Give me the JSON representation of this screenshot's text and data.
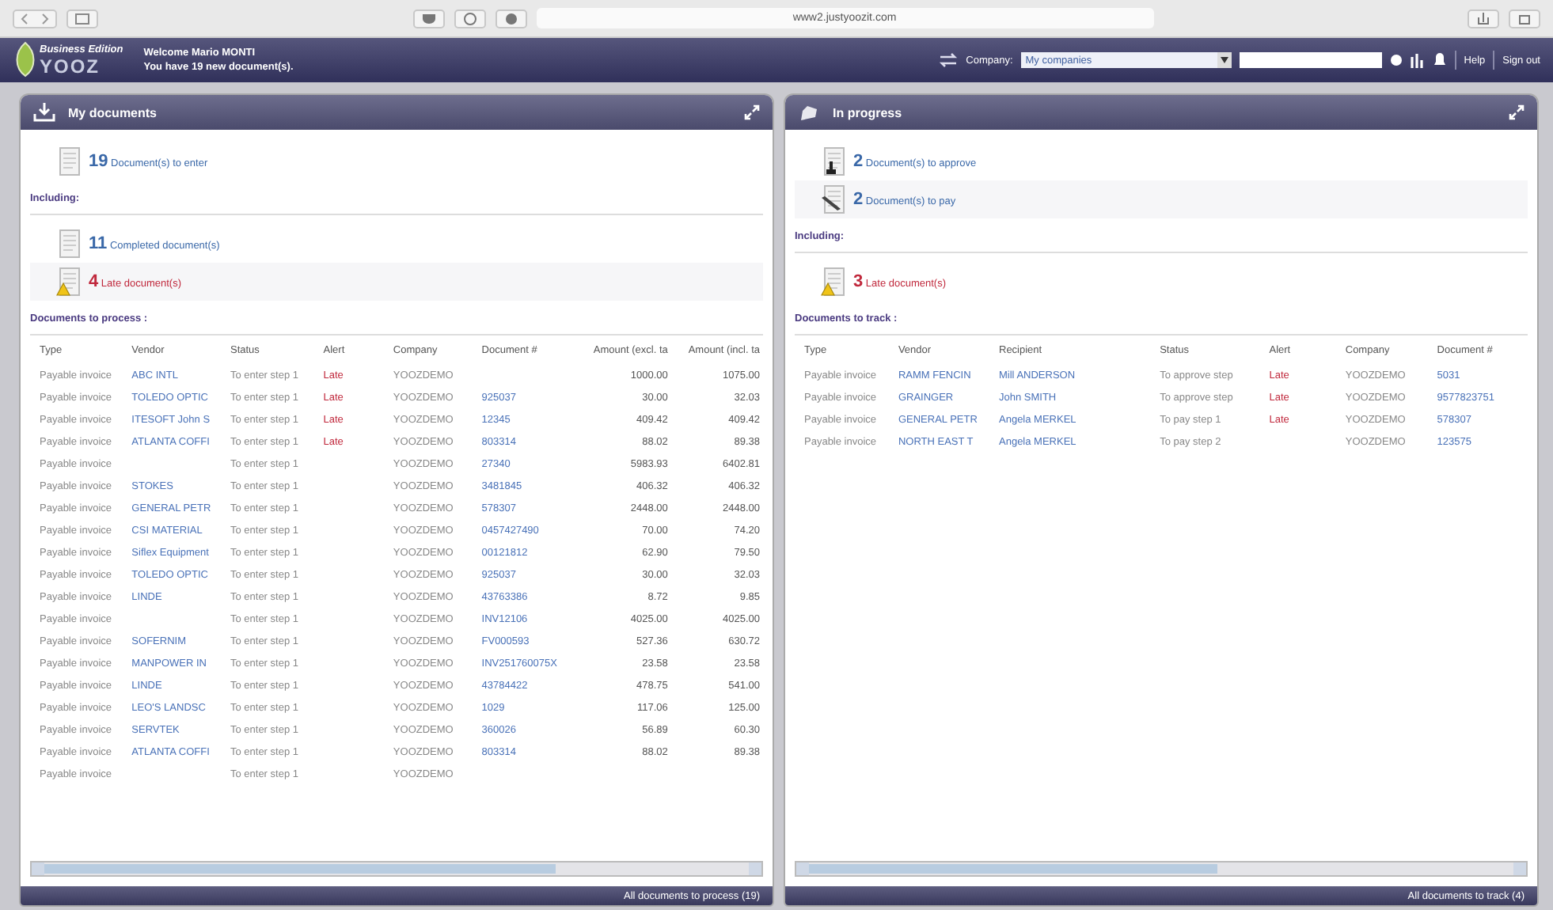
{
  "browser": {
    "url": "www2.justyoozit.com"
  },
  "header": {
    "logo": "YOOZ",
    "edition": "Business Edition",
    "welcome": "Welcome Mario MONTI",
    "new_docs": "You have **19** new document(s).",
    "company_label": "Company:",
    "company_value": "My companies",
    "help": "Help",
    "sign_out": "Sign out"
  },
  "panels": [
    {
      "title": "My documents",
      "summary": [
        {
          "count": "19",
          "label": "Document(s) to enter",
          "kind": "enter"
        }
      ],
      "including": "Including:",
      "sub_summary": [
        {
          "count": "11",
          "label": "Completed document(s)",
          "kind": "completed"
        },
        {
          "count": "4",
          "label": "Late document(s)",
          "kind": "late"
        }
      ],
      "section": "Documents to process :",
      "columns": [
        {
          "label": "Type",
          "kind": "text"
        },
        {
          "label": "Vendor",
          "kind": "link"
        },
        {
          "label": "Status",
          "kind": "text"
        },
        {
          "label": "Alert",
          "kind": "alert"
        },
        {
          "label": "Company",
          "kind": "text"
        },
        {
          "label": "Document #",
          "kind": "link"
        },
        {
          "label": "Amount (excl. ta",
          "kind": "number"
        },
        {
          "label": "Amount (incl. ta",
          "kind": "number"
        }
      ],
      "rows": [
        [
          "Payable invoice",
          "ABC INTL",
          "To enter step 1",
          "Late",
          "YOOZDEMO",
          null,
          "1000.00",
          "1075.00"
        ],
        [
          "Payable invoice",
          "TOLEDO OPTIC",
          "To enter step 1",
          "Late",
          "YOOZDEMO",
          "925037",
          "30.00",
          "32.03"
        ],
        [
          "Payable invoice",
          "ITESOFT John S",
          "To enter step 1",
          "Late",
          "YOOZDEMO",
          "12345",
          "409.42",
          "409.42"
        ],
        [
          "Payable invoice",
          "ATLANTA COFFI",
          "To enter step 1",
          "Late",
          "YOOZDEMO",
          "803314",
          "88.02",
          "89.38"
        ],
        [
          "Payable invoice",
          null,
          "To enter step 1",
          null,
          "YOOZDEMO",
          "27340",
          "5983.93",
          "6402.81"
        ],
        [
          "Payable invoice",
          "STOKES",
          "To enter step 1",
          null,
          "YOOZDEMO",
          "3481845",
          "406.32",
          "406.32"
        ],
        [
          "Payable invoice",
          "GENERAL PETR",
          "To enter step 1",
          null,
          "YOOZDEMO",
          "578307",
          "2448.00",
          "2448.00"
        ],
        [
          "Payable invoice",
          "CSI MATERIAL",
          "To enter step 1",
          null,
          "YOOZDEMO",
          "0457427490",
          "70.00",
          "74.20"
        ],
        [
          "Payable invoice",
          "Siflex Equipment",
          "To enter step 1",
          null,
          "YOOZDEMO",
          "00121812",
          "62.90",
          "79.50"
        ],
        [
          "Payable invoice",
          "TOLEDO OPTIC",
          "To enter step 1",
          null,
          "YOOZDEMO",
          "925037",
          "30.00",
          "32.03"
        ],
        [
          "Payable invoice",
          "LINDE",
          "To enter step 1",
          null,
          "YOOZDEMO",
          "43763386",
          "8.72",
          "9.85"
        ],
        [
          "Payable invoice",
          null,
          "To enter step 1",
          null,
          "YOOZDEMO",
          "INV12106",
          "4025.00",
          "4025.00"
        ],
        [
          "Payable invoice",
          "SOFERNIM",
          "To enter step 1",
          null,
          "YOOZDEMO",
          "FV000593",
          "527.36",
          "630.72"
        ],
        [
          "Payable invoice",
          "MANPOWER IN",
          "To enter step 1",
          null,
          "YOOZDEMO",
          "INV251760075X",
          "23.58",
          "23.58"
        ],
        [
          "Payable invoice",
          "LINDE",
          "To enter step 1",
          null,
          "YOOZDEMO",
          "43784422",
          "478.75",
          "541.00"
        ],
        [
          "Payable invoice",
          "LEO'S LANDSC",
          "To enter step 1",
          null,
          "YOOZDEMO",
          "1029",
          "117.06",
          "125.00"
        ],
        [
          "Payable invoice",
          "SERVTEK",
          "To enter step 1",
          null,
          "YOOZDEMO",
          "360026",
          "56.89",
          "60.30"
        ],
        [
          "Payable invoice",
          "ATLANTA COFFI",
          "To enter step 1",
          null,
          "YOOZDEMO",
          "803314",
          "88.02",
          "89.38"
        ],
        [
          "Payable invoice",
          null,
          "To enter step 1",
          null,
          "YOOZDEMO",
          null,
          null,
          null
        ]
      ],
      "footer_link": "All documents to process (19)"
    },
    {
      "title": "In progress",
      "summary": [
        {
          "count": "2",
          "label": "Document(s) to approve",
          "kind": "approve"
        },
        {
          "count": "2",
          "label": "Document(s) to pay",
          "kind": "pay"
        }
      ],
      "including": "Including:",
      "sub_summary": [
        {
          "count": "3",
          "label": "Late document(s)",
          "kind": "late"
        }
      ],
      "section": "Documents to track :",
      "columns": [
        {
          "label": "Type",
          "kind": "text"
        },
        {
          "label": "Vendor",
          "kind": "link"
        },
        {
          "label": "Recipient",
          "kind": "link"
        },
        {
          "label": "Status",
          "kind": "text"
        },
        {
          "label": "Alert",
          "kind": "alert"
        },
        {
          "label": "Company",
          "kind": "text"
        },
        {
          "label": "Document #",
          "kind": "link"
        }
      ],
      "rows": [
        [
          "Payable invoice",
          "RAMM FENCIN",
          "Mill ANDERSON",
          "To approve step",
          "Late",
          "YOOZDEMO",
          "5031"
        ],
        [
          "Payable invoice",
          "GRAINGER",
          "John SMITH",
          "To approve step",
          "Late",
          "YOOZDEMO",
          "9577823751"
        ],
        [
          "Payable invoice",
          "GENERAL PETR",
          "Angela MERKEL",
          "To pay step 1",
          "Late",
          "YOOZDEMO",
          "578307"
        ],
        [
          "Payable invoice",
          "NORTH EAST T",
          "Angela MERKEL",
          "To pay step 2",
          null,
          "YOOZDEMO",
          "123575"
        ]
      ],
      "footer_link": "All documents to track (4)"
    }
  ]
}
